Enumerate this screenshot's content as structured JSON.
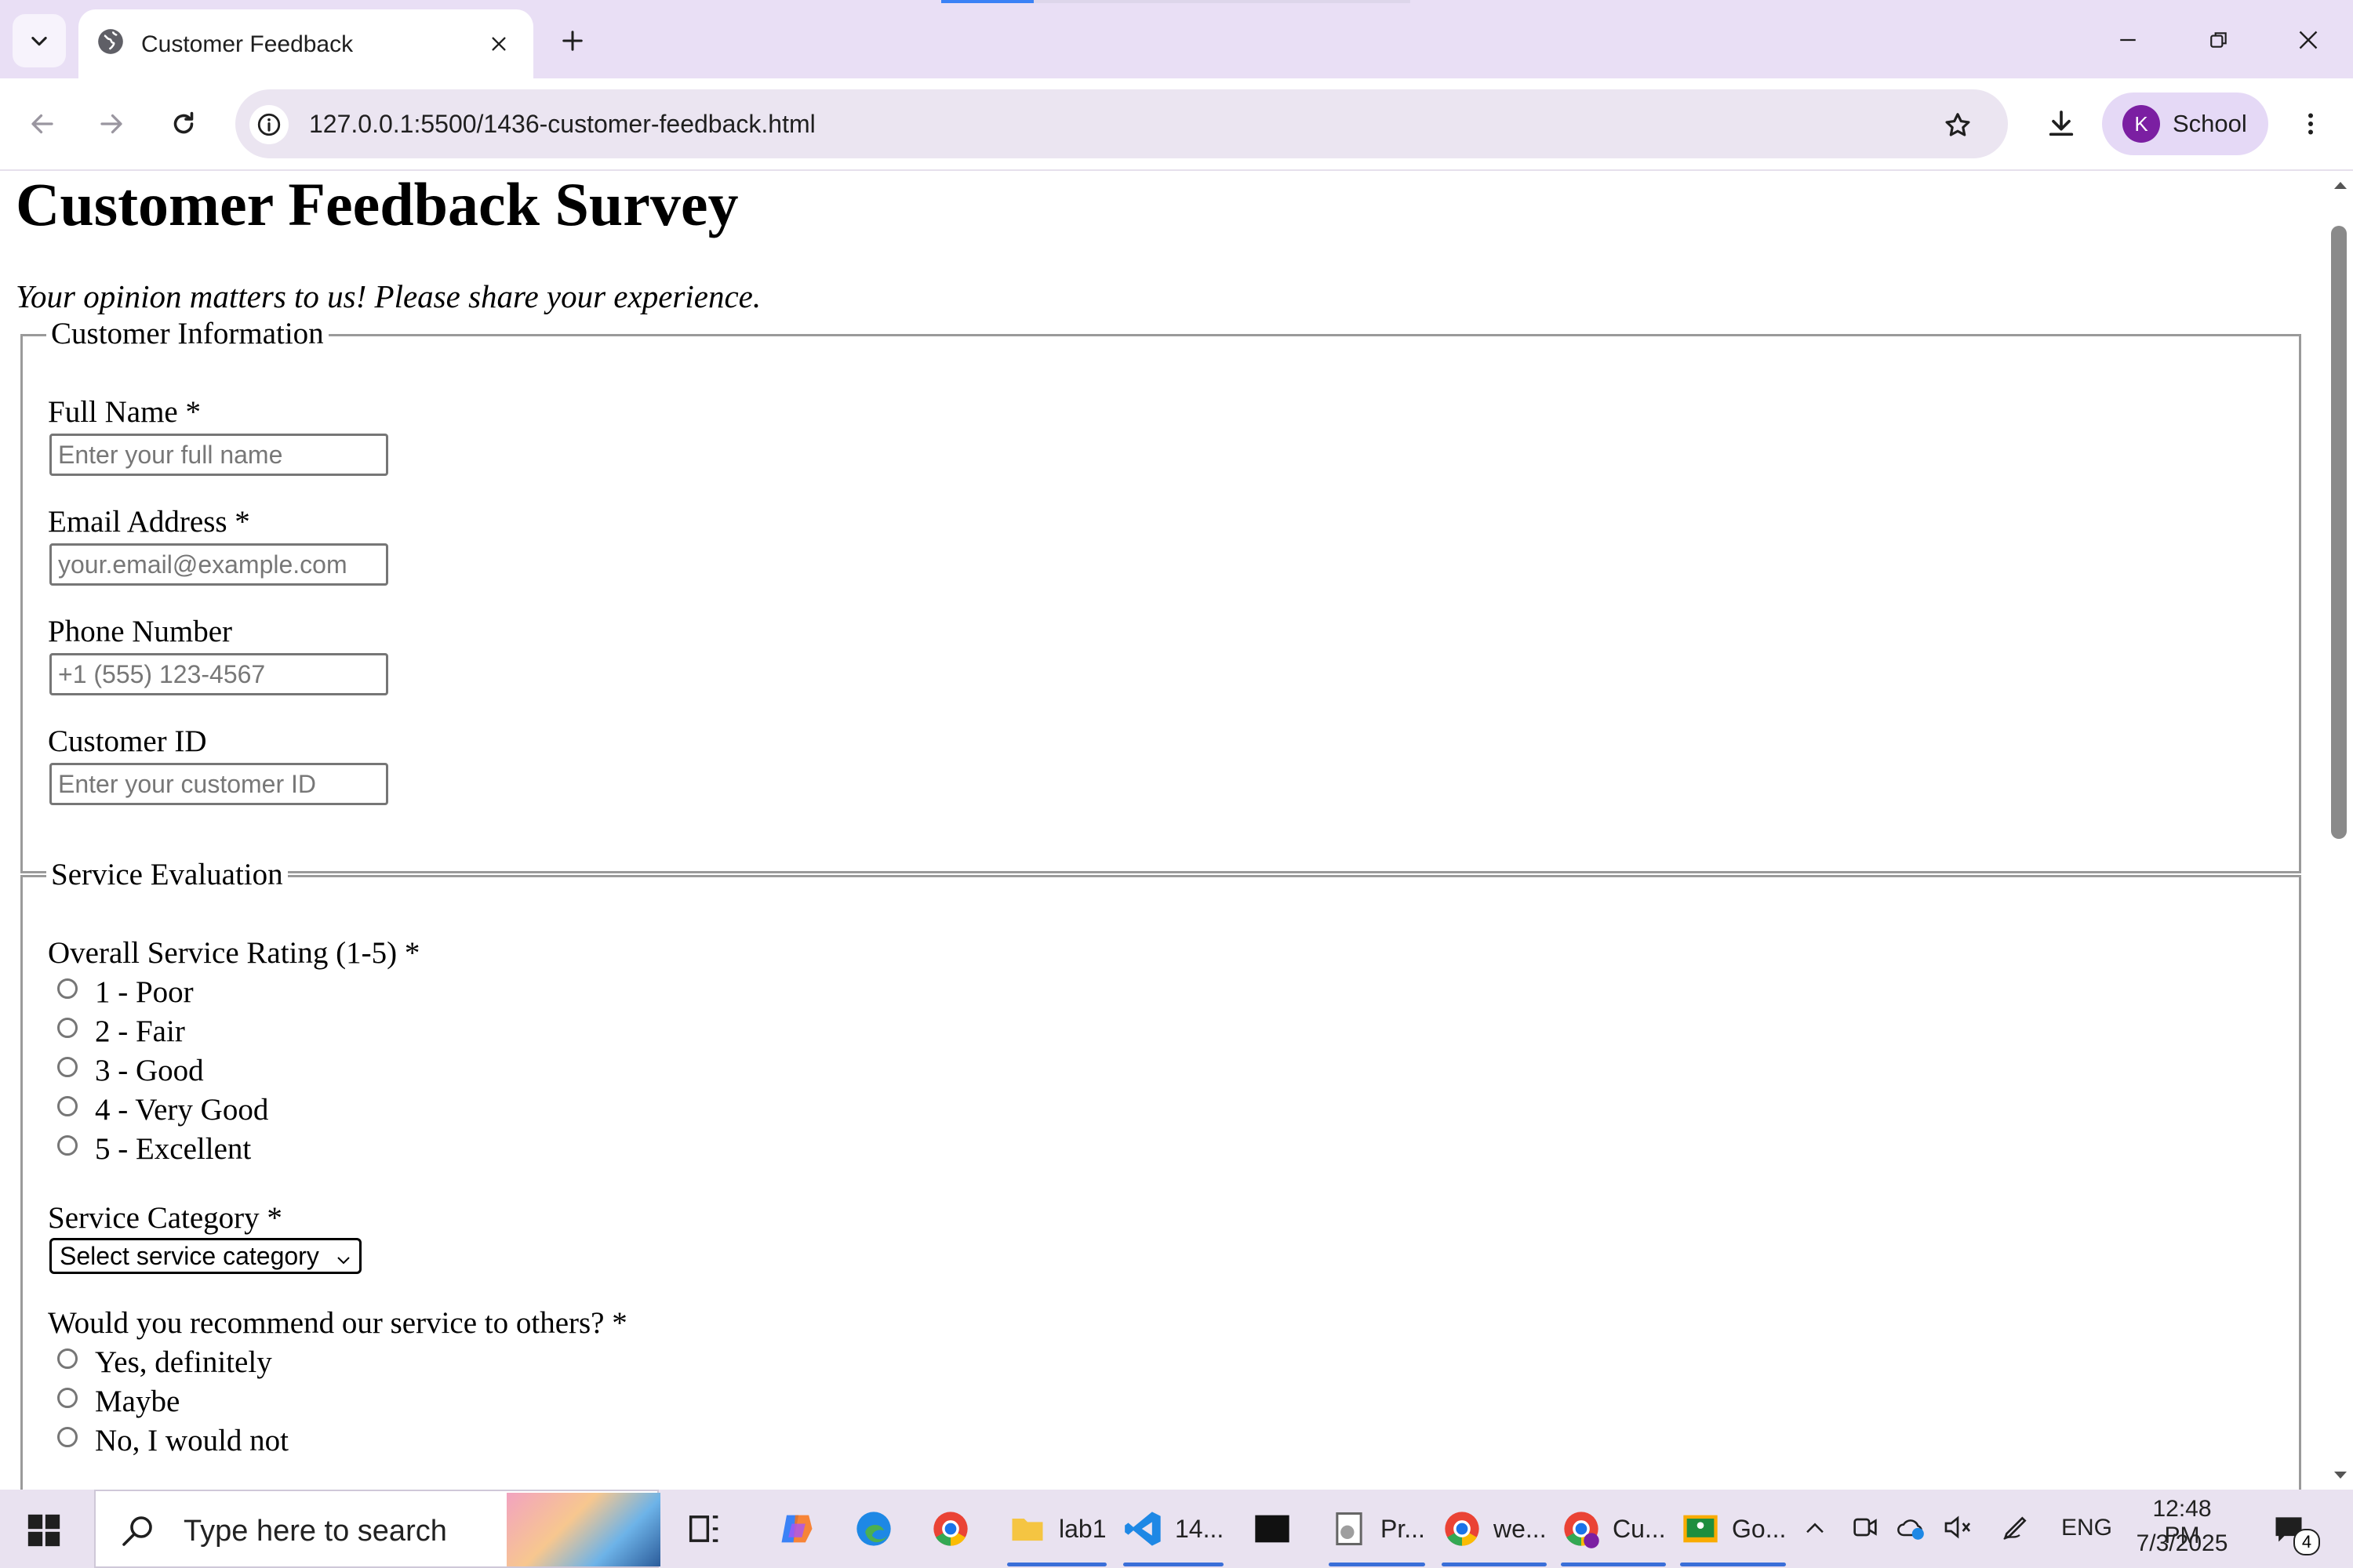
{
  "browser": {
    "tab_title": "Customer Feedback",
    "url": "127.0.0.1:5500/1436-customer-feedback.html",
    "profile_initial": "K",
    "profile_label": "School",
    "accent_color": "#7b1fa2",
    "icons": [
      "tab-search-icon",
      "globe-icon",
      "close-icon",
      "plus-icon",
      "minimize-icon",
      "restore-icon",
      "window-close-icon",
      "back-arrow-icon",
      "forward-arrow-icon",
      "reload-icon",
      "site-info-icon",
      "star-icon",
      "download-icon",
      "more-vert-icon"
    ]
  },
  "page": {
    "heading": "Customer Feedback Survey",
    "subtitle": "Your opinion matters to us! Please share your experience.",
    "customer_info": {
      "legend": "Customer Information",
      "full_name": {
        "label": "Full Name *",
        "placeholder": "Enter your full name",
        "value": ""
      },
      "email": {
        "label": "Email Address *",
        "placeholder": "your.email@example.com",
        "value": ""
      },
      "phone": {
        "label": "Phone Number",
        "placeholder": "+1 (555) 123-4567",
        "value": ""
      },
      "customer_id": {
        "label": "Customer ID",
        "placeholder": "Enter your customer ID",
        "value": ""
      }
    },
    "service_eval": {
      "legend": "Service Evaluation",
      "rating_label": "Overall Service Rating (1-5) *",
      "rating_options": [
        "1 - Poor",
        "2 - Fair",
        "3 - Good",
        "4 - Very Good",
        "5 - Excellent"
      ],
      "category_label": "Service Category *",
      "category_selected": "Select service category",
      "recommend_label": "Would you recommend our service to others? *",
      "recommend_options": [
        "Yes, definitely",
        "Maybe",
        "No, I would not"
      ]
    }
  },
  "taskbar": {
    "search_placeholder": "Type here to search",
    "apps": [
      {
        "name": "task-view",
        "label": ""
      },
      {
        "name": "copilot",
        "label": ""
      },
      {
        "name": "edge",
        "label": ""
      },
      {
        "name": "chrome",
        "label": ""
      },
      {
        "name": "file-explorer",
        "label": "lab1"
      },
      {
        "name": "vscode",
        "label": "14..."
      },
      {
        "name": "terminal",
        "label": ""
      },
      {
        "name": "project",
        "label": "Pr..."
      },
      {
        "name": "chrome-profile-1",
        "label": "we..."
      },
      {
        "name": "chrome-profile-2",
        "label": "Cu..."
      },
      {
        "name": "google-classroom",
        "label": "Go..."
      }
    ],
    "language": "ENG",
    "time": "12:48 PM",
    "date": "7/3/2025",
    "notification_count": "4"
  }
}
